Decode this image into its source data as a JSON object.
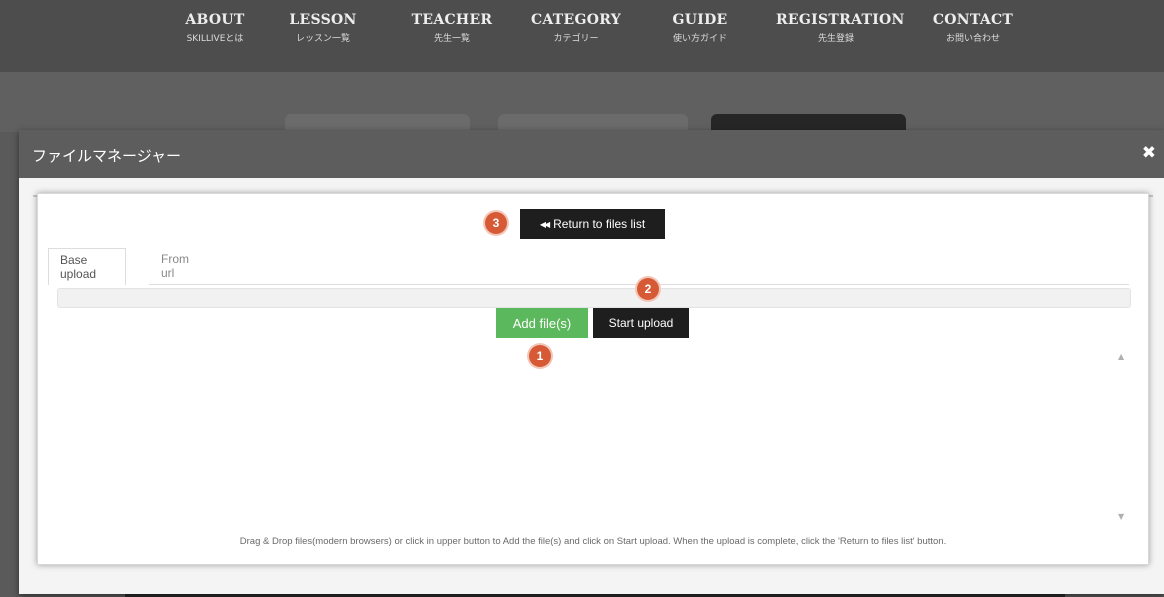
{
  "nav": {
    "items": [
      {
        "en": "ABOUT",
        "jp": "SKILLIVEとは"
      },
      {
        "en": "LESSON",
        "jp": "レッスン一覧"
      },
      {
        "en": "TEACHER",
        "jp": "先生一覧"
      },
      {
        "en": "CATEGORY",
        "jp": "カテゴリー"
      },
      {
        "en": "GUIDE",
        "jp": "使い方ガイド"
      },
      {
        "en": "REGISTRATION",
        "jp": "先生登録"
      },
      {
        "en": "CONTACT",
        "jp": "お問い合わせ"
      }
    ]
  },
  "modal": {
    "title": "ファイルマネージャー",
    "close_icon": "✖"
  },
  "uploader": {
    "return_icon": "◀◀",
    "return_label": "Return to files list",
    "tabs": [
      {
        "label": "Base upload",
        "active": true
      },
      {
        "label": "From url",
        "active": false
      }
    ],
    "add_label": "Add file(s)",
    "start_label": "Start upload",
    "hint": "Drag & Drop files(modern browsers) or click in upper button to Add the file(s) and click on Start upload. When the upload is complete, click the 'Return to files list' button."
  },
  "badges": {
    "one": "1",
    "two": "2",
    "three": "3"
  },
  "scroll": {
    "up": "▲",
    "down": "▼"
  },
  "colors": {
    "accent_green": "#5cb85c",
    "dark_button": "#1e1e1e",
    "badge_orange": "#d75a37",
    "header_gray": "#5d5d5d"
  }
}
